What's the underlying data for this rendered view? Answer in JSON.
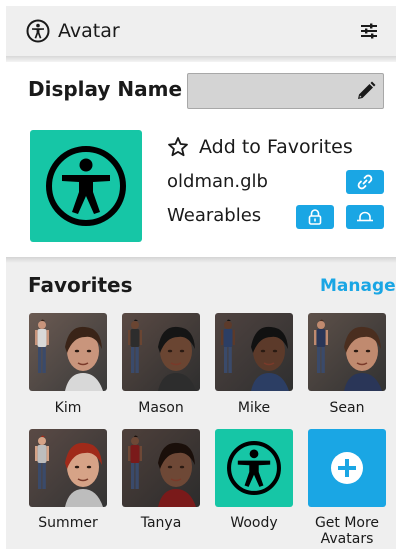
{
  "header": {
    "title": "Avatar"
  },
  "display_name": {
    "label": "Display Name",
    "value": ""
  },
  "current": {
    "add_favorites": "Add to Favorites",
    "file": "oldman.glb",
    "wearables": "Wearables"
  },
  "favorites": {
    "title": "Favorites",
    "manage": "Manage",
    "items": [
      {
        "name": "Kim"
      },
      {
        "name": "Mason"
      },
      {
        "name": "Mike"
      },
      {
        "name": "Sean"
      },
      {
        "name": "Summer"
      },
      {
        "name": "Tanya"
      },
      {
        "name": "Woody"
      },
      {
        "name": "Get More Avatars"
      }
    ]
  },
  "colors": {
    "accent": "#1aa6e4",
    "teal": "#16c6a6",
    "panel": "#efefef"
  }
}
